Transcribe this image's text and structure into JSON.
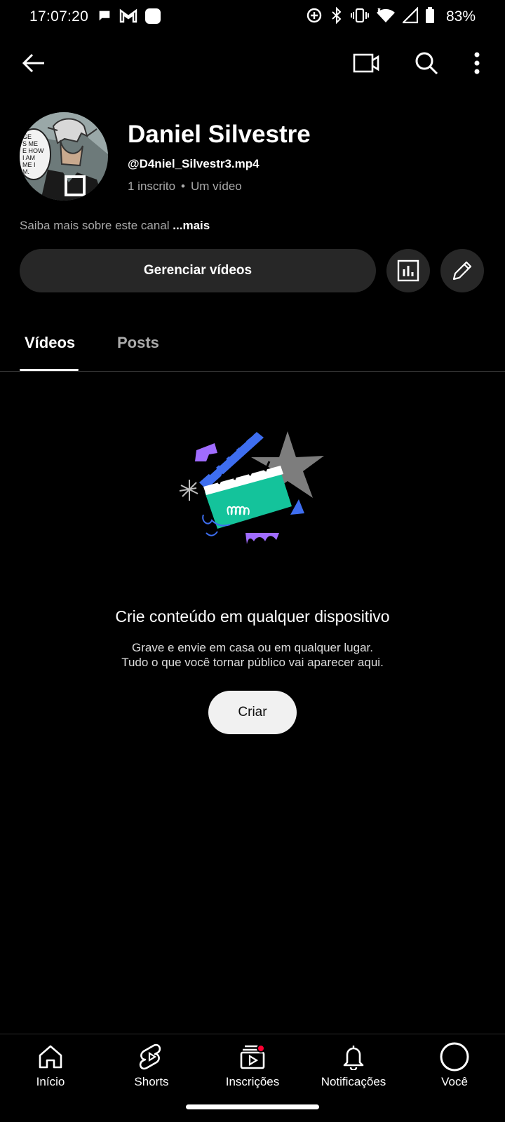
{
  "status_bar": {
    "time": "17:07:20",
    "battery": "83%"
  },
  "channel": {
    "name": "Daniel Silvestre",
    "handle": "@D4niel_Silvestr3.mp4",
    "subscribers": "1 inscrito",
    "separator": "•",
    "video_count": "Um vídeo",
    "about": "Saiba mais sobre este canal",
    "about_more": "...mais",
    "avatar_text": [
      "GE",
      "S ME",
      "E HOW",
      "I AM",
      "ME I",
      "M."
    ]
  },
  "actions": {
    "manage_videos": "Gerenciar vídeos"
  },
  "tabs": [
    {
      "label": "Vídeos",
      "selected": true
    },
    {
      "label": "Posts",
      "selected": false
    }
  ],
  "empty_state": {
    "title": "Crie conteúdo em qualquer dispositivo",
    "line1": "Grave e envie em casa ou em qualquer lugar.",
    "line2": "Tudo o que você tornar público vai aparecer aqui.",
    "button": "Criar"
  },
  "bottom_nav": [
    {
      "label": "Início",
      "icon": "home-icon"
    },
    {
      "label": "Shorts",
      "icon": "shorts-icon"
    },
    {
      "label": "Inscrições",
      "icon": "subscriptions-icon",
      "badge": true
    },
    {
      "label": "Notificações",
      "icon": "bell-icon"
    },
    {
      "label": "Você",
      "icon": "profile-icon"
    }
  ],
  "colors": {
    "background": "#000000",
    "button_dark": "#272727",
    "button_light": "#f1f1f1",
    "badge_red": "#ff0033",
    "muted_text": "#aaaaaa"
  }
}
